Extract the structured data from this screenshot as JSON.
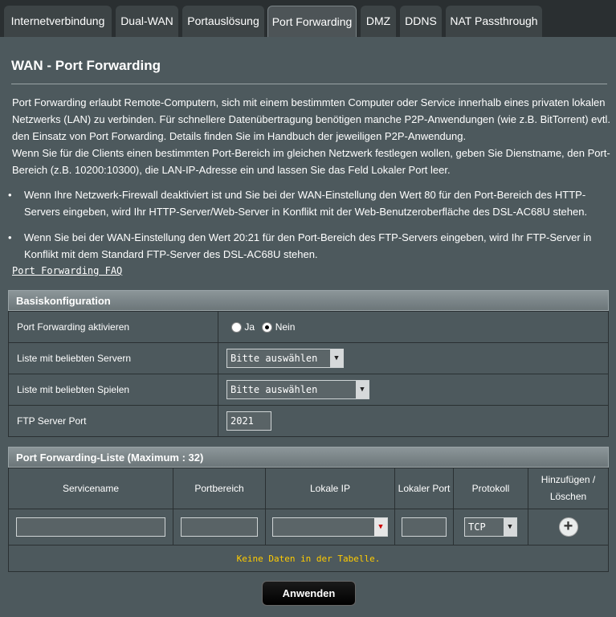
{
  "tabs": [
    {
      "label": "Internetverbindung"
    },
    {
      "label": "Dual-WAN"
    },
    {
      "label": "Portauslösung"
    },
    {
      "label": "Port Forwarding"
    },
    {
      "label": "DMZ"
    },
    {
      "label": "DDNS"
    },
    {
      "label": "NAT Passthrough"
    }
  ],
  "page": {
    "title": "WAN - Port Forwarding",
    "desc1": "Port Forwarding erlaubt Remote-Computern, sich mit einem bestimmten Computer oder Service innerhalb eines privaten lokalen Netzwerks (LAN) zu verbinden. Für schnellere Datenübertragung benötigen manche P2P-Anwendungen (wie z.B. BitTorrent) evtl. den Einsatz von Port Forwarding. Details finden Sie im Handbuch der jeweiligen P2P-Anwendung.",
    "desc2": "Wenn Sie für die Clients einen bestimmten Port-Bereich im gleichen Netzwerk festlegen wollen, geben Sie Dienstname, den Port-Bereich (z.B. 10200:10300), die LAN-IP-Adresse ein und lassen Sie das Feld Lokaler Port leer.",
    "bullet1": "Wenn Ihre Netzwerk-Firewall deaktiviert ist und Sie bei der WAN-Einstellung den Wert 80 für den Port-Bereich des HTTP-Servers eingeben, wird Ihr HTTP-Server/Web-Server in Konflikt mit der Web-Benutzeroberfläche des DSL-AC68U stehen.",
    "bullet2": "Wenn Sie bei der WAN-Einstellung den Wert 20:21 für den Port-Bereich des FTP-Servers eingeben, wird Ihr FTP-Server in Konflikt mit dem Standard FTP-Server des DSL-AC68U stehen.",
    "faq": "Port Forwarding FAQ"
  },
  "basic": {
    "header": "Basiskonfiguration",
    "enable_label": "Port Forwarding aktivieren",
    "yes": "Ja",
    "no": "Nein",
    "servers_label": "Liste mit beliebten Servern",
    "servers_value": "Bitte auswählen",
    "games_label": "Liste mit beliebten Spielen",
    "games_value": "Bitte auswählen",
    "ftp_label": "FTP Server Port",
    "ftp_value": "2021"
  },
  "list": {
    "header": "Port Forwarding-Liste (Maximum : 32)",
    "col_service": "Servicename",
    "col_range": "Portbereich",
    "col_ip": "Lokale IP",
    "col_local_port": "Lokaler Port",
    "col_protocol": "Protokoll",
    "col_addremove": "Hinzufügen / Löschen",
    "protocol_value": "TCP",
    "empty": "Keine Daten in der Tabelle."
  },
  "apply_label": "Anwenden"
}
